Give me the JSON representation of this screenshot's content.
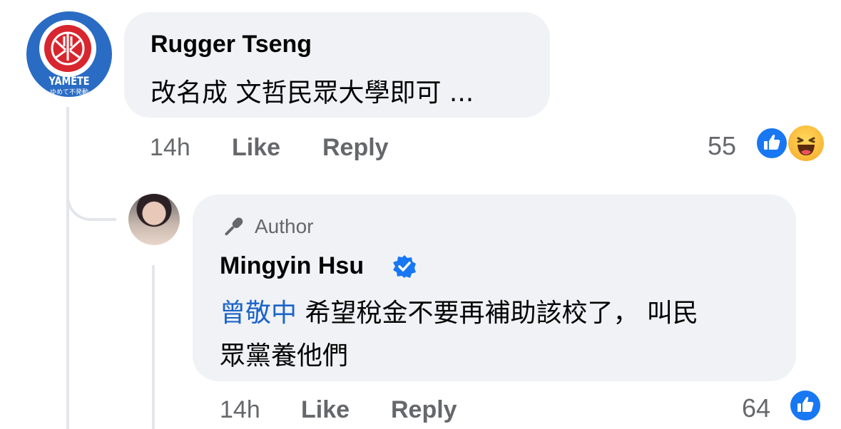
{
  "comments": [
    {
      "author": "Rugger Tseng",
      "avatar_label": "YAMETE",
      "avatar_sublabel": "ゆめて不発動",
      "text": "改名成 文哲民眾大學即可 ...",
      "time": "14h",
      "like_label": "Like",
      "reply_label": "Reply",
      "reaction_count": "55",
      "reactions": [
        "like-icon",
        "haha-icon"
      ]
    },
    {
      "badge": "Author",
      "author": "Mingyin Hsu",
      "verified": true,
      "mention": "曾敬中",
      "text_line1": "希望稅金不要再補助該校了， 叫民",
      "text_line2": "眾黨養他們",
      "time": "14h",
      "like_label": "Like",
      "reply_label": "Reply",
      "reaction_count": "64",
      "reactions": [
        "like-icon"
      ]
    }
  ],
  "colors": {
    "bubble": "#f0f2f5",
    "mention": "#1b64c8",
    "meta": "#65676b",
    "like": "#1877f2",
    "thread_line": "#e4e6eb"
  }
}
